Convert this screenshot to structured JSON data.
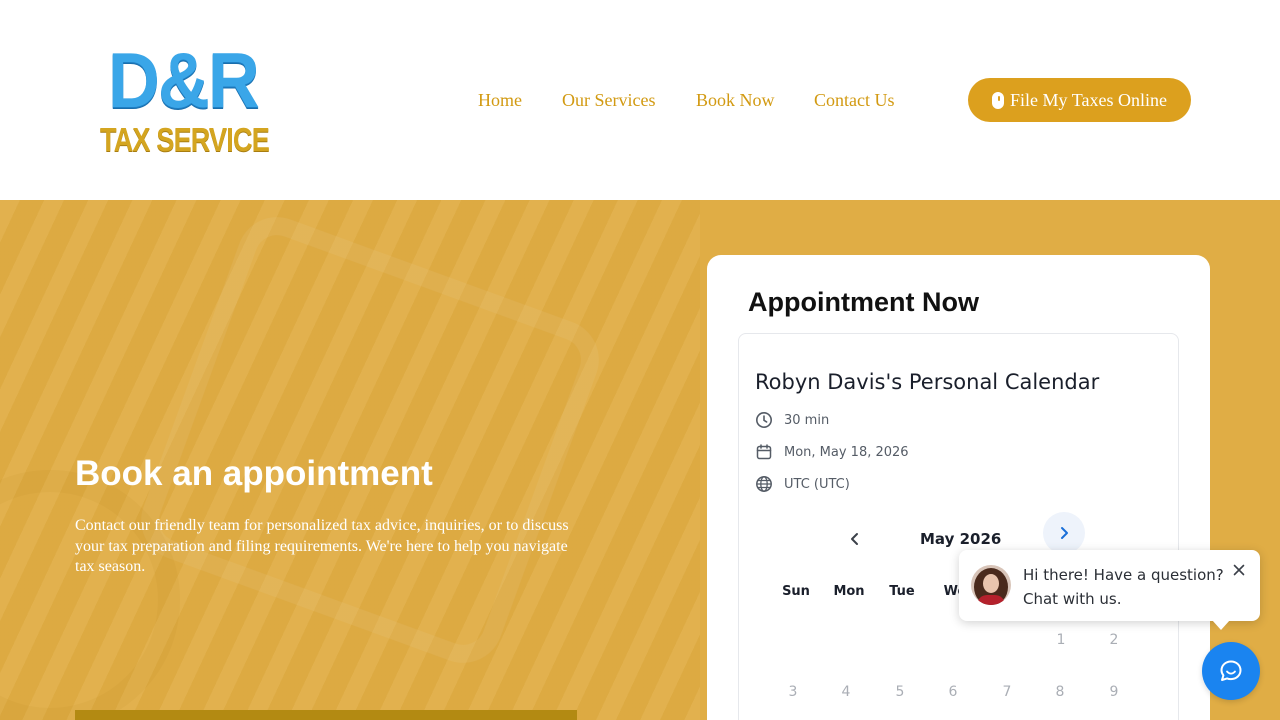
{
  "brand": {
    "logo_top": "D&R",
    "logo_bottom": "TAX SERVICE"
  },
  "nav": {
    "items": [
      {
        "label": "Home"
      },
      {
        "label": "Our Services"
      },
      {
        "label": "Book Now"
      },
      {
        "label": "Contact Us"
      }
    ],
    "cta_label": "File My Taxes Online",
    "cta_icon": "mouse-icon"
  },
  "hero": {
    "heading": "Book an appointment",
    "body": "Contact our friendly team for personalized tax advice, inquiries, or to discuss your tax preparation and filing requirements. We're here to help you navigate tax season."
  },
  "appointment": {
    "heading": "Appointment Now",
    "calendar": {
      "title": "Robyn Davis's Personal Calendar",
      "duration": "30 min",
      "date": "Mon, May 18, 2026",
      "timezone": "UTC (UTC)",
      "month_label": "May 2026",
      "weekdays": [
        "Sun",
        "Mon",
        "Tue",
        "We"
      ],
      "week1": [
        "1",
        "2"
      ],
      "week2": [
        "3",
        "4",
        "5",
        "6",
        "7",
        "8",
        "9"
      ]
    }
  },
  "chat": {
    "line1": "Hi there! Have a question?",
    "line2": "Chat with us."
  },
  "colors": {
    "accent": "#dca01e",
    "nav_text": "#d29a12",
    "hero_bg": "#e0ad45",
    "chat_blue": "#1a84f0"
  }
}
